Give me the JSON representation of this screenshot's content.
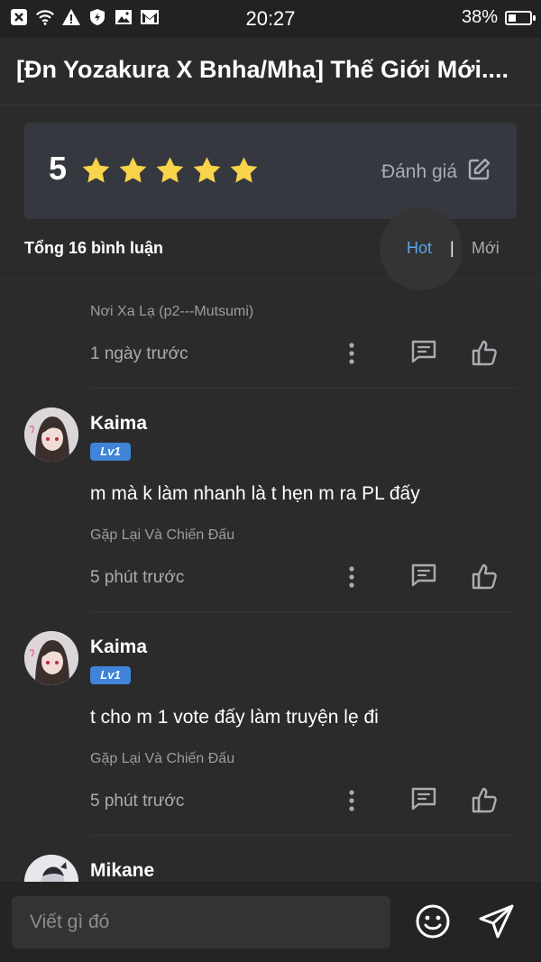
{
  "status_bar": {
    "time": "20:27",
    "battery": "38%",
    "battery_level": 0.38,
    "icons": [
      "close-box-icon",
      "wifi-icon",
      "warning-icon",
      "shield-icon",
      "image-icon",
      "gmail-icon"
    ]
  },
  "header": {
    "title": "[Ɖn Yozakura X Bnha/Mha] Thế Giới Mới...."
  },
  "rating": {
    "score": "5",
    "stars": 5,
    "rate_label": "Đánh giá"
  },
  "comments_header": {
    "count_label": "Tổng 16 bình luận",
    "sort_hot": "Hot",
    "separator": "|",
    "sort_new": "Mới"
  },
  "comments": [
    {
      "chapter": "Nơi Xa Lạ (p2---Mutsumi)",
      "time": "1 ngày trước"
    },
    {
      "name": "Kaima",
      "level": "Lv1",
      "text": "m mà k làm nhanh là t hẹn m ra PL đấy",
      "chapter": "Gặp Lại Và Chiến Đấu",
      "time": "5 phút trước"
    },
    {
      "name": "Kaima",
      "level": "Lv1",
      "text": "t cho m 1 vote đấy làm truyện lẹ đi",
      "chapter": "Gặp Lại Và Chiến Đấu",
      "time": "5 phút trước"
    },
    {
      "name": "Mikane"
    }
  ],
  "composer": {
    "placeholder": "Viết gì đó"
  },
  "colors": {
    "background": "#2b2b2b",
    "card": "#35393f",
    "accent_blue": "#5aa4f0",
    "star": "#f9d34a",
    "badge": "#3f84d9"
  }
}
